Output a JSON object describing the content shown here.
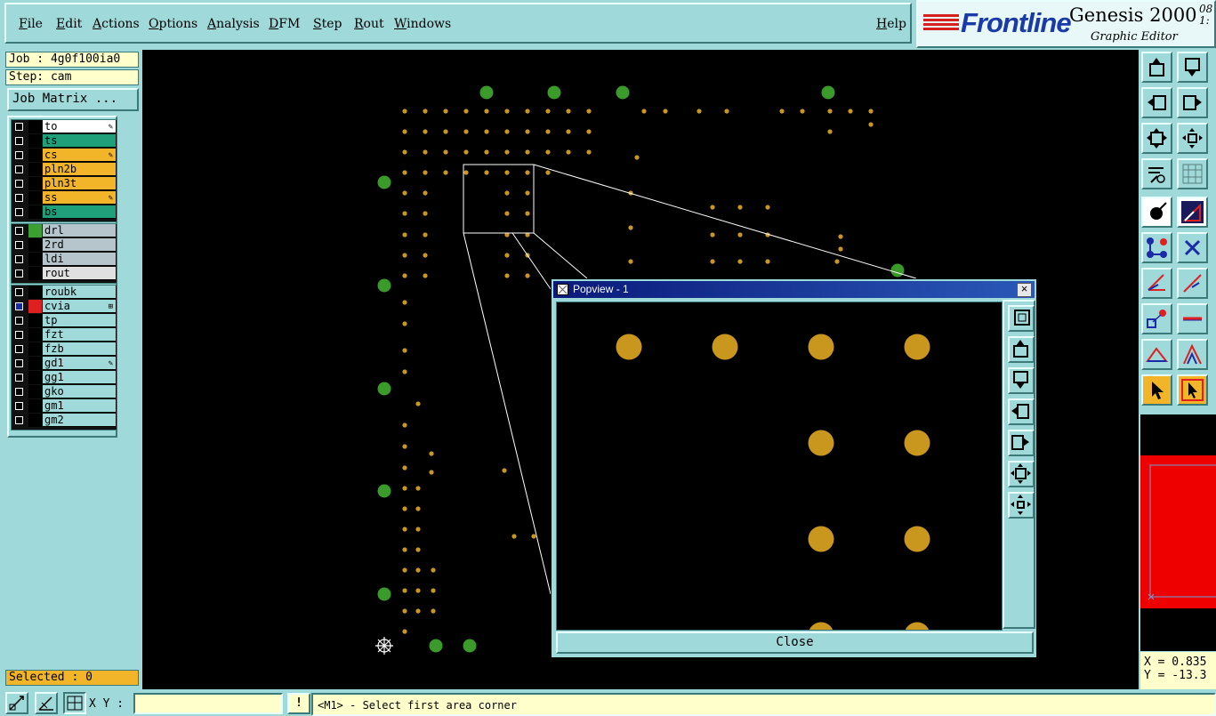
{
  "menu": {
    "file": "File",
    "edit": "Edit",
    "actions": "Actions",
    "options": "Options",
    "analysis": "Analysis",
    "dfm": "DFM",
    "step": "Step",
    "rout": "Rout",
    "windows": "Windows",
    "help": "Help"
  },
  "logo": {
    "brand": "Frontline",
    "product": "Genesis 2000",
    "subtitle": "Graphic Editor",
    "version_top": "08",
    "version_bottom": "1:"
  },
  "job": {
    "label": "Job : 4g0f100ia0",
    "step": "Step: cam"
  },
  "job_matrix_button": "Job Matrix ...",
  "layers": {
    "board": [
      {
        "name": "to",
        "bg": "#ffffff",
        "swatch": "#000000",
        "flag": "✎",
        "checked": false
      },
      {
        "name": "ts",
        "bg": "#1fa07a",
        "swatch": "#000000",
        "flag": "",
        "checked": false
      },
      {
        "name": "cs",
        "bg": "#f2b52a",
        "swatch": "#000000",
        "flag": "✎",
        "checked": false
      },
      {
        "name": "pln2b",
        "bg": "#f2b52a",
        "swatch": "#000000",
        "flag": "",
        "checked": false
      },
      {
        "name": "pln3t",
        "bg": "#f2b52a",
        "swatch": "#000000",
        "flag": "",
        "checked": false
      },
      {
        "name": "ss",
        "bg": "#f2b52a",
        "swatch": "#000000",
        "flag": "✎",
        "checked": false
      },
      {
        "name": "bs",
        "bg": "#1fa07a",
        "swatch": "#000000",
        "flag": "",
        "checked": false
      }
    ],
    "drill": [
      {
        "name": "drl",
        "bg": "#b6c4cc",
        "swatch": "#3aa030",
        "flag": "",
        "checked": false
      },
      {
        "name": "2rd",
        "bg": "#b6c4cc",
        "swatch": "#000000",
        "flag": "",
        "checked": false
      },
      {
        "name": "ldi",
        "bg": "#b6c4cc",
        "swatch": "#000000",
        "flag": "",
        "checked": false
      },
      {
        "name": "rout",
        "bg": "#e0e0e0",
        "swatch": "#000000",
        "flag": "",
        "checked": false
      }
    ],
    "misc": [
      {
        "name": "roubk",
        "bg": "#9fd9d9",
        "swatch": "#000000",
        "flag": "",
        "checked": false
      },
      {
        "name": "cvia",
        "bg": "#9fd9d9",
        "swatch": "#e02020",
        "flag": "⊞",
        "checked": true
      },
      {
        "name": "tp",
        "bg": "#9fd9d9",
        "swatch": "#000000",
        "flag": "",
        "checked": false
      },
      {
        "name": "fzt",
        "bg": "#9fd9d9",
        "swatch": "#000000",
        "flag": "",
        "checked": false
      },
      {
        "name": "fzb",
        "bg": "#9fd9d9",
        "swatch": "#000000",
        "flag": "",
        "checked": false
      },
      {
        "name": "gd1",
        "bg": "#9fd9d9",
        "swatch": "#000000",
        "flag": "✎",
        "checked": false
      },
      {
        "name": "gg1",
        "bg": "#9fd9d9",
        "swatch": "#000000",
        "flag": "",
        "checked": false
      },
      {
        "name": "gko",
        "bg": "#9fd9d9",
        "swatch": "#000000",
        "flag": "",
        "checked": false
      },
      {
        "name": "gm1",
        "bg": "#9fd9d9",
        "swatch": "#000000",
        "flag": "",
        "checked": false
      },
      {
        "name": "gm2",
        "bg": "#9fd9d9",
        "swatch": "#000000",
        "flag": "",
        "checked": false
      }
    ]
  },
  "selected": "Selected : 0",
  "coords": {
    "x": "X = 0.835",
    "y": "Y = -13.3"
  },
  "status": {
    "xy_label": "X Y :",
    "xy_value": "",
    "excl": "!",
    "message": "<M1> - Select first area corner"
  },
  "popview": {
    "title": "Popview - 1",
    "close_label": "Close",
    "close_x": "×"
  },
  "colors": {
    "pad": "#c9961e",
    "drill": "#3a9a2a",
    "panel": "#9fd9d9",
    "input": "#ffffcc",
    "highlight": "#f2b52a"
  }
}
